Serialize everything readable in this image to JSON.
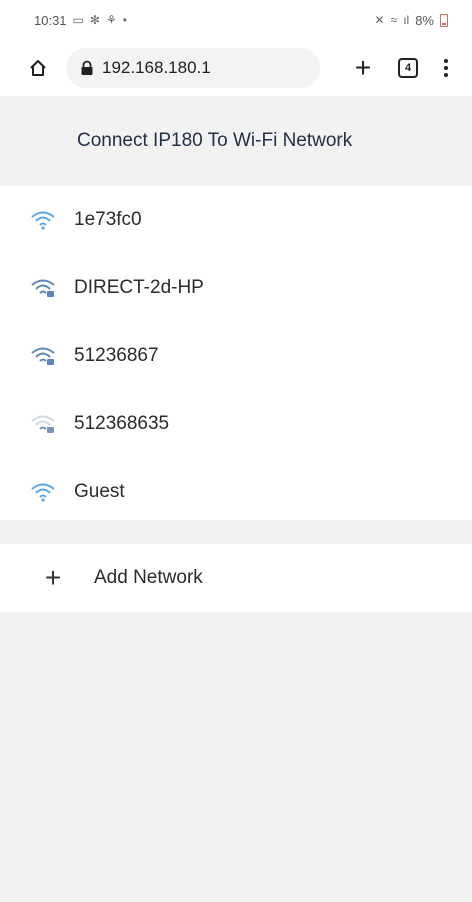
{
  "status_bar": {
    "time": "10:31",
    "battery": "8%"
  },
  "browser": {
    "url": "192.168.180.1",
    "tab_count": "4",
    "new_tab_label": "+"
  },
  "page": {
    "title": "Connect IP180 To Wi-Fi Network",
    "networks": [
      {
        "ssid": "1e73fc0",
        "icon": "wifi-full-icon",
        "color": "#5aa5e0"
      },
      {
        "ssid": "DIRECT-2d-HP",
        "icon": "wifi-secure-icon",
        "color": "#5f86b8"
      },
      {
        "ssid": "51236867",
        "icon": "wifi-secure-icon",
        "color": "#5f86b8"
      },
      {
        "ssid": "512368635",
        "icon": "wifi-weak-secure-icon",
        "color": "#7a95b5"
      },
      {
        "ssid": "Guest",
        "icon": "wifi-full-icon",
        "color": "#5aa5e0"
      }
    ],
    "add_network": {
      "icon": "+",
      "label": "Add Network"
    }
  }
}
